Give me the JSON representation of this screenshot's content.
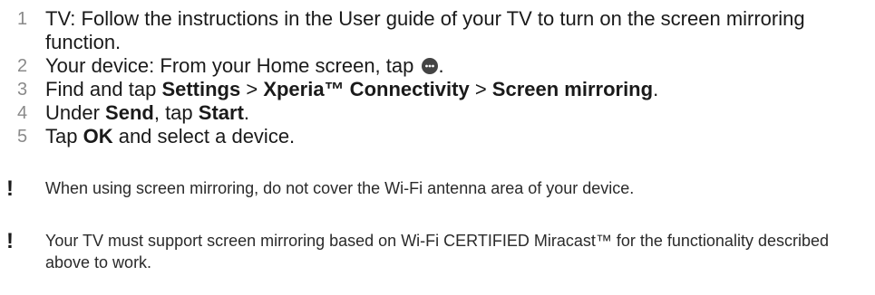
{
  "steps": [
    {
      "number": "1",
      "parts": [
        "TV: Follow the instructions in the User guide of your TV to turn on the screen mirroring function."
      ]
    },
    {
      "number": "2",
      "parts": [
        "Your device: From your Home screen, tap ",
        "."
      ],
      "icon": "apps-icon"
    },
    {
      "number": "3",
      "parts": [
        "Find and tap ",
        "Settings",
        " > ",
        "Xperia™ Connectivity",
        " > ",
        "Screen mirroring",
        "."
      ]
    },
    {
      "number": "4",
      "parts": [
        "Under ",
        "Send",
        ", tap ",
        "Start",
        "."
      ]
    },
    {
      "number": "5",
      "parts": [
        "Tap ",
        "OK",
        " and select a device."
      ]
    }
  ],
  "notes": [
    {
      "icon": "!",
      "text": "When using screen mirroring, do not cover the Wi-Fi antenna area of your device."
    },
    {
      "icon": "!",
      "text": "Your TV must support screen mirroring based on Wi-Fi CERTIFIED Miracast™ for the functionality described above to work."
    }
  ]
}
